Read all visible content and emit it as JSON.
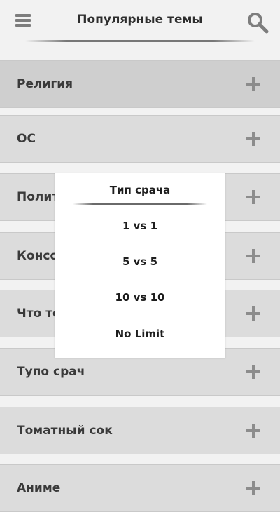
{
  "header": {
    "title": "Популярные темы",
    "menu_icon": "hamburger-menu-icon",
    "search_icon": "search-icon"
  },
  "topics": [
    {
      "label": "Религия",
      "active": true
    },
    {
      "label": "ОС"
    },
    {
      "label": "Полит"
    },
    {
      "label": "Консо"
    },
    {
      "label": "Что то"
    },
    {
      "label": "Тупо срач"
    },
    {
      "label": "Томатный сок"
    },
    {
      "label": "Аниме"
    }
  ],
  "dialog": {
    "title": "Тип срача",
    "options": [
      "1 vs 1",
      "5 vs 5",
      "10 vs 10",
      "No Limit"
    ]
  },
  "colors": {
    "background": "#f2f2f2",
    "item_background": "#dcdcdc",
    "item_active_background": "#cfcfcf",
    "icon_gray": "#8c8c8c",
    "dialog_background": "#ffffff"
  }
}
